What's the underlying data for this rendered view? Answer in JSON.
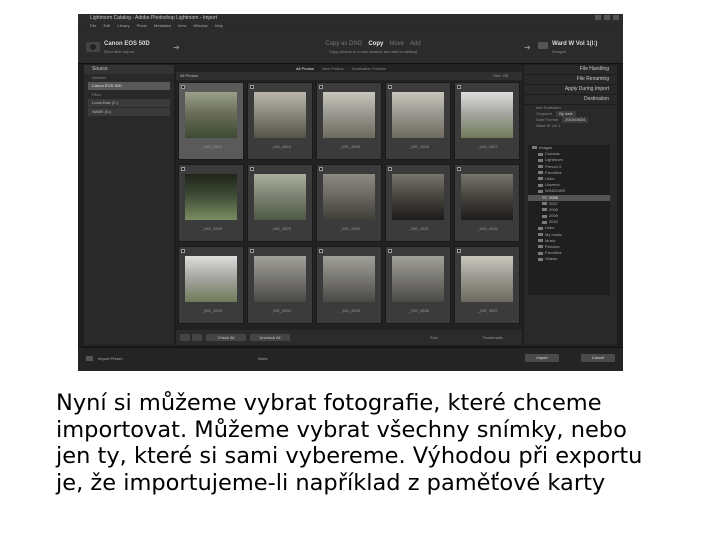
{
  "colors": {
    "app_bg": "#1e1e1e",
    "panel_bg": "#292929",
    "selected_cell": "#5a5a5a",
    "text_light": "#c8c8c8"
  },
  "caption": {
    "lines": [
      "Nyní si můžeme vybrat fotografie, které chceme",
      "importovat. Můžeme vybrat všechny snímky, nebo",
      "jen ty, které si sami vybereme. Výhodou při exportu",
      "je, že importujeme-li například z paměťové karty"
    ]
  },
  "app": {
    "window_title": "Lightroom Catalog - Adobe Photoshop Lightroom - Import",
    "menu": [
      "File",
      "Edit",
      "Library",
      "Photo",
      "Metadata",
      "View",
      "Window",
      "Help"
    ],
    "source": {
      "name": "Canon EOS 50D",
      "sub": "Eject after import"
    },
    "modes": {
      "items": [
        "Copy as DNG",
        "Copy",
        "Move",
        "Add"
      ],
      "active_index": 1,
      "description": "Copy photos to a new location and add to catalog"
    },
    "destination": {
      "name": "Ward W Vol 1(I:)",
      "sub": "/Images"
    },
    "left_panel": {
      "header": "Source",
      "devices_label": "Devices",
      "device_item": "Canon EOS 50D",
      "files_label": "Files",
      "drives": [
        "Local Disk (C:)",
        "NAME (D:)"
      ]
    },
    "view_tabs": [
      "All Photos",
      "New Photos",
      "Destination Folders"
    ],
    "view_tab_active": 0,
    "grid_header": {
      "label": "All Photos",
      "sort": "Sort: Off"
    },
    "thumbs": [
      {
        "label": "_MG_4523",
        "selected": true,
        "icon": "doorway-photo"
      },
      {
        "label": "_MG_4524",
        "selected": false,
        "icon": "corridor-photo"
      },
      {
        "label": "_MG_4525",
        "selected": false,
        "icon": "ruin-photo"
      },
      {
        "label": "_MG_4526",
        "selected": false,
        "icon": "ruin-photo"
      },
      {
        "label": "_MG_4527",
        "selected": false,
        "icon": "building-photo"
      },
      {
        "label": "_MG_4528",
        "selected": false,
        "icon": "window-photo"
      },
      {
        "label": "_MG_4529",
        "selected": false,
        "icon": "street-photo"
      },
      {
        "label": "_MG_4530",
        "selected": false,
        "icon": "gate-photo"
      },
      {
        "label": "_MG_4531",
        "selected": false,
        "icon": "tunnel-photo"
      },
      {
        "label": "_MG_4532",
        "selected": false,
        "icon": "tunnel-photo"
      },
      {
        "label": "_MG_4533",
        "selected": false,
        "icon": "building-photo"
      },
      {
        "label": "_MG_4534",
        "selected": false,
        "icon": "stairs-photo"
      },
      {
        "label": "_MG_4535",
        "selected": false,
        "icon": "stairs-photo"
      },
      {
        "label": "_MG_4536",
        "selected": false,
        "icon": "stairs-photo"
      },
      {
        "label": "_MG_4537",
        "selected": false,
        "icon": "ruin-photo"
      }
    ],
    "bottom_bar": {
      "check_all": "Check All",
      "uncheck_all": "Uncheck All",
      "sort_label": "Sort:",
      "thumbnails_label": "Thumbnails"
    },
    "right_panel": {
      "headers": [
        "File Handling",
        "File Renaming",
        "Apply During Import",
        "Destination"
      ],
      "subfolder_label": "Into Subfolder",
      "organize_label": "Organize",
      "organize_value": "By date",
      "date_format_label": "Date Format",
      "date_format_value": "2010/08/24",
      "volume": "Ward W Vol 1",
      "tree": [
        "Images",
        "Cuestas",
        "Lightroom",
        "Prevod 3",
        "Favorites",
        "Links",
        "Ulozeno",
        "WINDOWS",
        "2006",
        "2007",
        "2008",
        "2009",
        "2010",
        "Links",
        "My music",
        "Music",
        "Pictures",
        "Favorites",
        "Videos"
      ],
      "tree_selected_index": 8
    },
    "status": {
      "preset_label": "Import Preset :",
      "preset_value": "None",
      "import_button": "Import",
      "cancel_button": "Cancel"
    }
  }
}
